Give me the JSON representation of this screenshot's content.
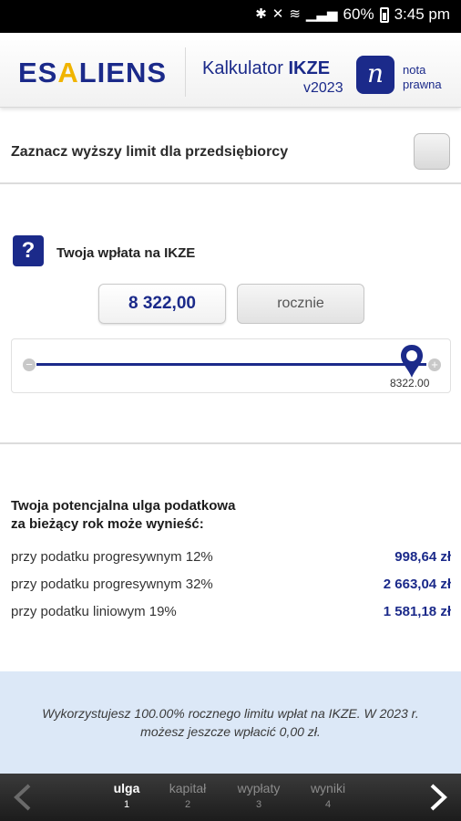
{
  "status_bar": {
    "battery": "60%",
    "time": "3:45 pm"
  },
  "header": {
    "logo_part1": "ES",
    "logo_accent": "A",
    "logo_part2": "LIENS",
    "title_prefix": "Kalkulator ",
    "title_bold": "IKZE",
    "version": "v2023",
    "nota_icon_letter": "n",
    "nota_line1": "nota",
    "nota_line2": "prawna"
  },
  "entrepreneur_option": {
    "label": "Zaznacz wyższy limit dla przedsiębiorcy",
    "checked": false
  },
  "contribution": {
    "help_icon": "?",
    "label": "Twoja wpłata na IKZE",
    "amount": "8 322,00",
    "period": "rocznie",
    "slider_value": "8322.00",
    "slider_fraction": 1.0
  },
  "relief": {
    "title_line1": "Twoja potencjalna ulga podatkowa",
    "title_line2": "za bieżący rok może wynieść:",
    "rows": [
      {
        "label": "przy podatku progresywnym 12%",
        "value": "998,64 zł"
      },
      {
        "label": "przy podatku progresywnym 32%",
        "value": "2 663,04 zł"
      },
      {
        "label": "przy podatku liniowym 19%",
        "value": "1 581,18 zł"
      }
    ]
  },
  "info": {
    "line1": "Wykorzystujesz 100.00% rocznego limitu wpłat na IKZE. W 2023 r.",
    "line2": "możesz jeszcze wpłacić 0,00 zł."
  },
  "bottom_nav": {
    "steps": [
      {
        "label": "ulga",
        "num": "1",
        "active": true
      },
      {
        "label": "kapitał",
        "num": "2",
        "active": false
      },
      {
        "label": "wypłaty",
        "num": "3",
        "active": false
      },
      {
        "label": "wyniki",
        "num": "4",
        "active": false
      }
    ]
  },
  "colors": {
    "brand_blue": "#1b2a8a",
    "accent_yellow": "#f0b400",
    "info_bg": "#dce8f7"
  }
}
